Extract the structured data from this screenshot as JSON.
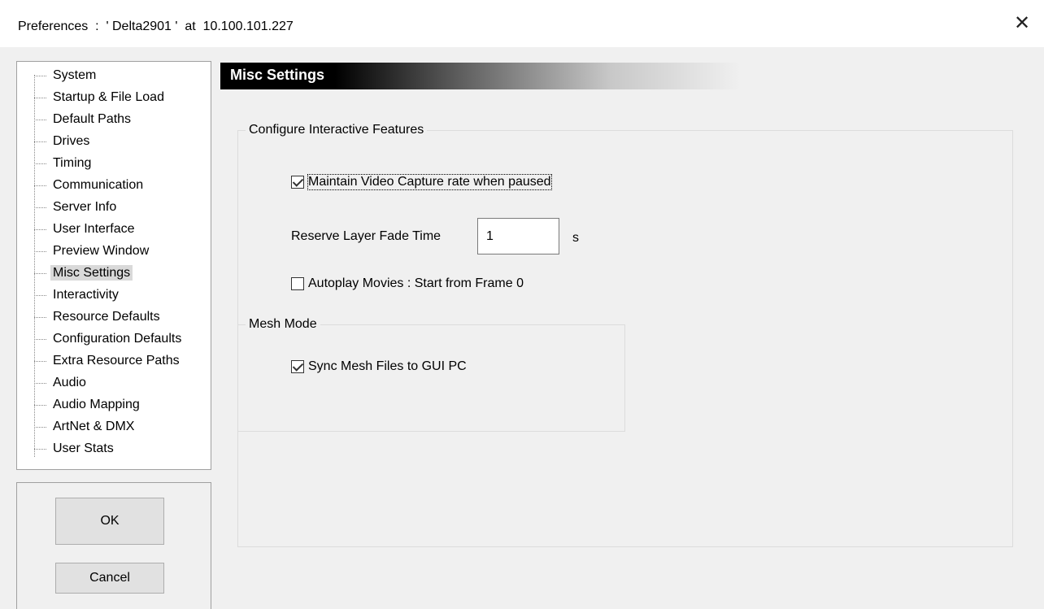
{
  "window": {
    "title": "Preferences  :  ' Delta2901 '  at  10.100.101.227",
    "close_glyph": "✕"
  },
  "sidebar": {
    "items": [
      {
        "label": "System"
      },
      {
        "label": "Startup & File Load"
      },
      {
        "label": "Default Paths"
      },
      {
        "label": "Drives"
      },
      {
        "label": "Timing"
      },
      {
        "label": "Communication"
      },
      {
        "label": "Server Info"
      },
      {
        "label": "User Interface"
      },
      {
        "label": "Preview Window"
      },
      {
        "label": "Misc Settings",
        "selected": true
      },
      {
        "label": "Interactivity"
      },
      {
        "label": "Resource Defaults"
      },
      {
        "label": "Configuration Defaults"
      },
      {
        "label": "Extra Resource Paths"
      },
      {
        "label": "Audio"
      },
      {
        "label": "Audio Mapping"
      },
      {
        "label": "ArtNet & DMX"
      },
      {
        "label": "User Stats"
      }
    ]
  },
  "buttons": {
    "ok": "OK",
    "cancel": "Cancel"
  },
  "main": {
    "banner_title": "Misc Settings",
    "interactive_group": {
      "legend": "Configure Interactive Features",
      "maintain_capture": {
        "label": "Maintain Video Capture rate when paused",
        "checked": true
      },
      "fade_time": {
        "label": "Reserve Layer Fade Time",
        "value": "1",
        "unit": "s"
      },
      "autoplay": {
        "label": "Autoplay Movies : Start from Frame 0",
        "checked": false
      }
    },
    "mesh_group": {
      "legend": "Mesh Mode",
      "sync_mesh": {
        "label": "Sync Mesh Files to GUI PC",
        "checked": true
      }
    }
  }
}
